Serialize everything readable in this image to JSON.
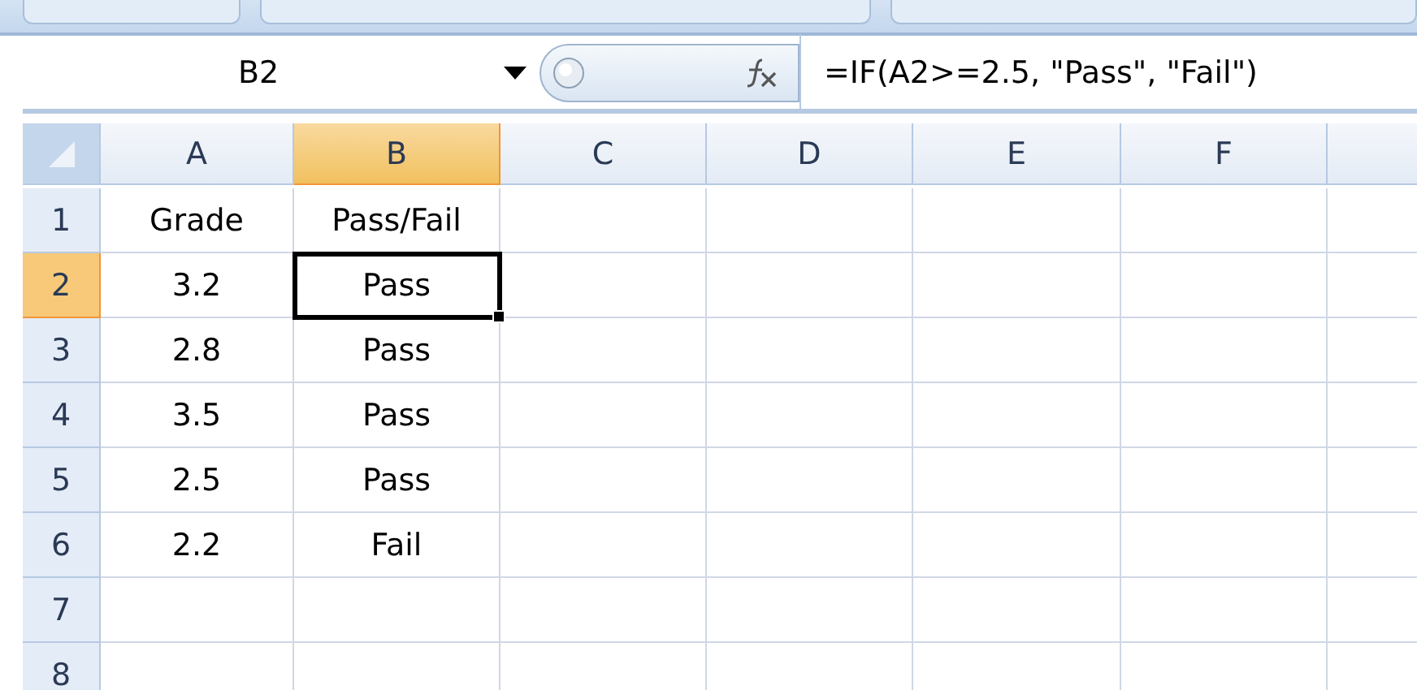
{
  "name_box": "B2",
  "formula": "=IF(A2>=2.5, \"Pass\", \"Fail\")",
  "columns": [
    {
      "label": "A",
      "selected": false
    },
    {
      "label": "B",
      "selected": true
    },
    {
      "label": "C",
      "selected": false
    },
    {
      "label": "D",
      "selected": false
    },
    {
      "label": "E",
      "selected": false
    },
    {
      "label": "F",
      "selected": false
    }
  ],
  "rows": [
    {
      "number": "1",
      "selected": false,
      "cells": [
        {
          "text": "Grade",
          "selected": false
        },
        {
          "text": "Pass/Fail",
          "selected": false
        }
      ]
    },
    {
      "number": "2",
      "selected": true,
      "cells": [
        {
          "text": "3.2",
          "selected": false
        },
        {
          "text": "Pass",
          "selected": true
        }
      ]
    },
    {
      "number": "3",
      "selected": false,
      "cells": [
        {
          "text": "2.8",
          "selected": false
        },
        {
          "text": "Pass",
          "selected": false
        }
      ]
    },
    {
      "number": "4",
      "selected": false,
      "cells": [
        {
          "text": "3.5",
          "selected": false
        },
        {
          "text": "Pass",
          "selected": false
        }
      ]
    },
    {
      "number": "5",
      "selected": false,
      "cells": [
        {
          "text": "2.5",
          "selected": false
        },
        {
          "text": "Pass",
          "selected": false
        }
      ]
    },
    {
      "number": "6",
      "selected": false,
      "cells": [
        {
          "text": "2.2",
          "selected": false
        },
        {
          "text": "Fail",
          "selected": false
        }
      ]
    },
    {
      "number": "7",
      "selected": false
    },
    {
      "number": "8",
      "selected": false
    }
  ]
}
